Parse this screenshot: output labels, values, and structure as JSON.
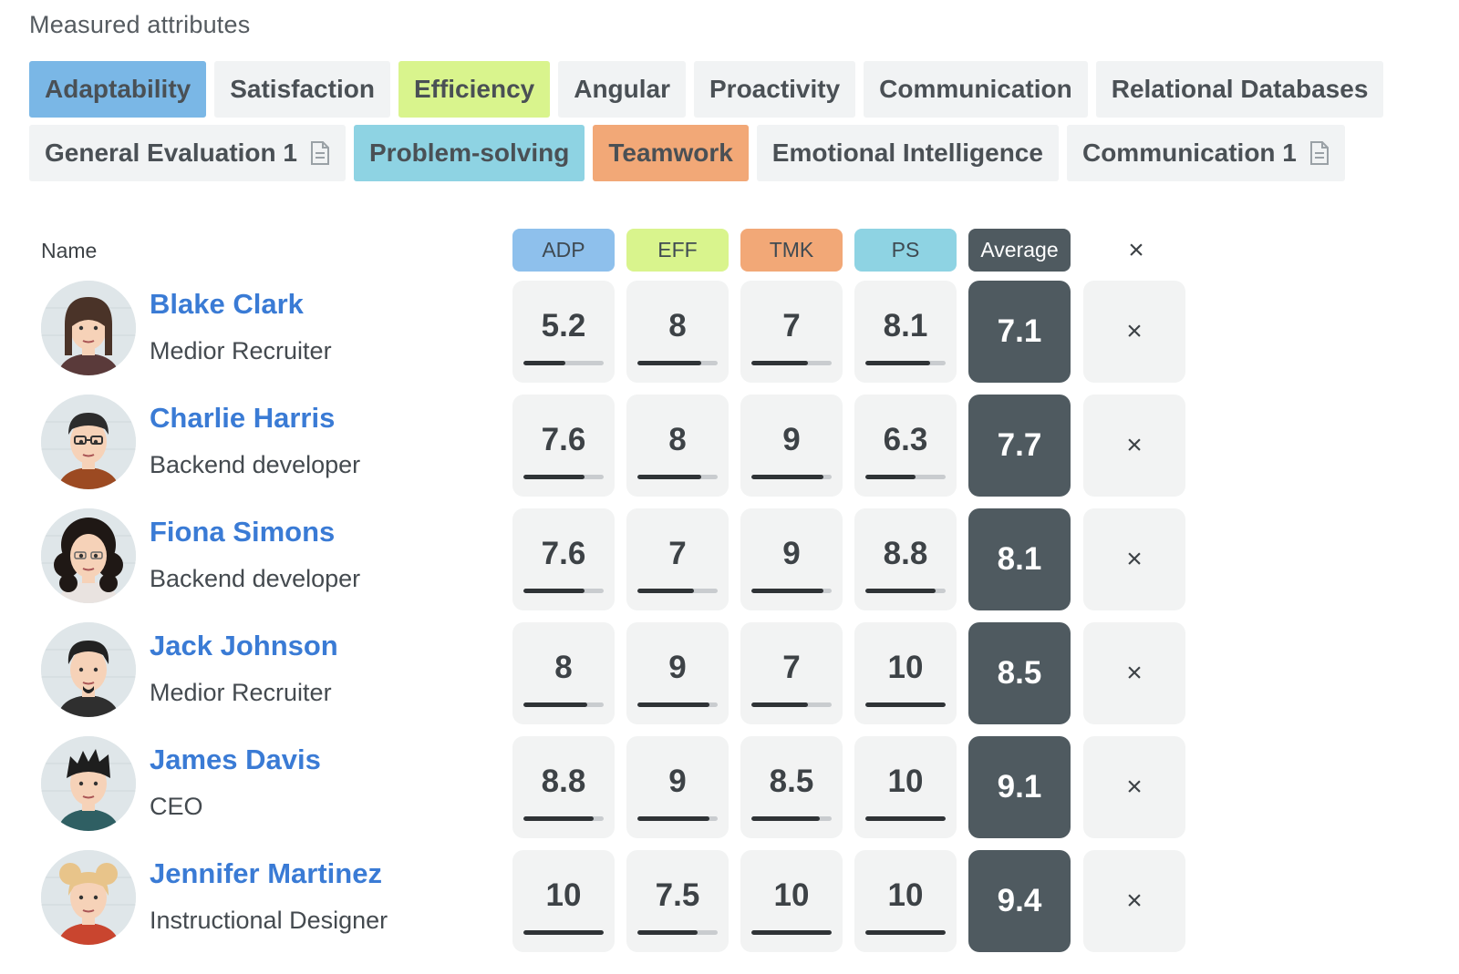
{
  "section_title": "Measured attributes",
  "tags_row1": [
    {
      "label": "Adaptability",
      "color": "#7ab7e6",
      "has_doc": false
    },
    {
      "label": "Satisfaction",
      "color": "#f1f3f4",
      "has_doc": false
    },
    {
      "label": "Efficiency",
      "color": "#d9f48d",
      "has_doc": false
    },
    {
      "label": "Angular",
      "color": "#f1f3f4",
      "has_doc": false
    },
    {
      "label": "Proactivity",
      "color": "#f1f3f4",
      "has_doc": false
    },
    {
      "label": "Communication",
      "color": "#f1f3f4",
      "has_doc": false
    },
    {
      "label": "Relational Databases",
      "color": "#f1f3f4",
      "has_doc": false
    }
  ],
  "tags_row2": [
    {
      "label": "General Evaluation 1",
      "color": "#f1f3f4",
      "has_doc": true
    },
    {
      "label": "Problem-solving",
      "color": "#8ed3e3",
      "has_doc": false
    },
    {
      "label": "Teamwork",
      "color": "#f2a877",
      "has_doc": false
    },
    {
      "label": "Emotional Intelligence",
      "color": "#f1f3f4",
      "has_doc": false
    },
    {
      "label": "Communication 1",
      "color": "#f1f3f4",
      "has_doc": true
    }
  ],
  "table": {
    "name_header": "Name",
    "columns": [
      {
        "label": "ADP",
        "color": "#8ec0ec"
      },
      {
        "label": "EFF",
        "color": "#d9f48d"
      },
      {
        "label": "TMK",
        "color": "#f2a877"
      },
      {
        "label": "PS",
        "color": "#8ed3e3"
      }
    ],
    "average_label": "Average",
    "close_glyph": "×",
    "max_score": 10,
    "rows": [
      {
        "name": "Blake Clark",
        "role": "Medior Recruiter",
        "scores": [
          "5.2",
          "8",
          "7",
          "8.1"
        ],
        "average": "7.1",
        "avatar": "woman-braids-icon"
      },
      {
        "name": "Charlie Harris",
        "role": "Backend developer",
        "scores": [
          "7.6",
          "8",
          "9",
          "6.3"
        ],
        "average": "7.7",
        "avatar": "man-glasses-icon"
      },
      {
        "name": "Fiona Simons",
        "role": "Backend developer",
        "scores": [
          "7.6",
          "7",
          "9",
          "8.8"
        ],
        "average": "8.1",
        "avatar": "woman-curly-icon"
      },
      {
        "name": "Jack Johnson",
        "role": "Medior Recruiter",
        "scores": [
          "8",
          "9",
          "7",
          "10"
        ],
        "average": "8.5",
        "avatar": "man-goatee-icon"
      },
      {
        "name": "James Davis",
        "role": "CEO",
        "scores": [
          "8.8",
          "9",
          "8.5",
          "10"
        ],
        "average": "9.1",
        "avatar": "man-spiky-hair-icon"
      },
      {
        "name": "Jennifer Martinez",
        "role": "Instructional Designer",
        "scores": [
          "10",
          "7.5",
          "10",
          "10"
        ],
        "average": "9.4",
        "avatar": "woman-buns-icon"
      }
    ]
  }
}
